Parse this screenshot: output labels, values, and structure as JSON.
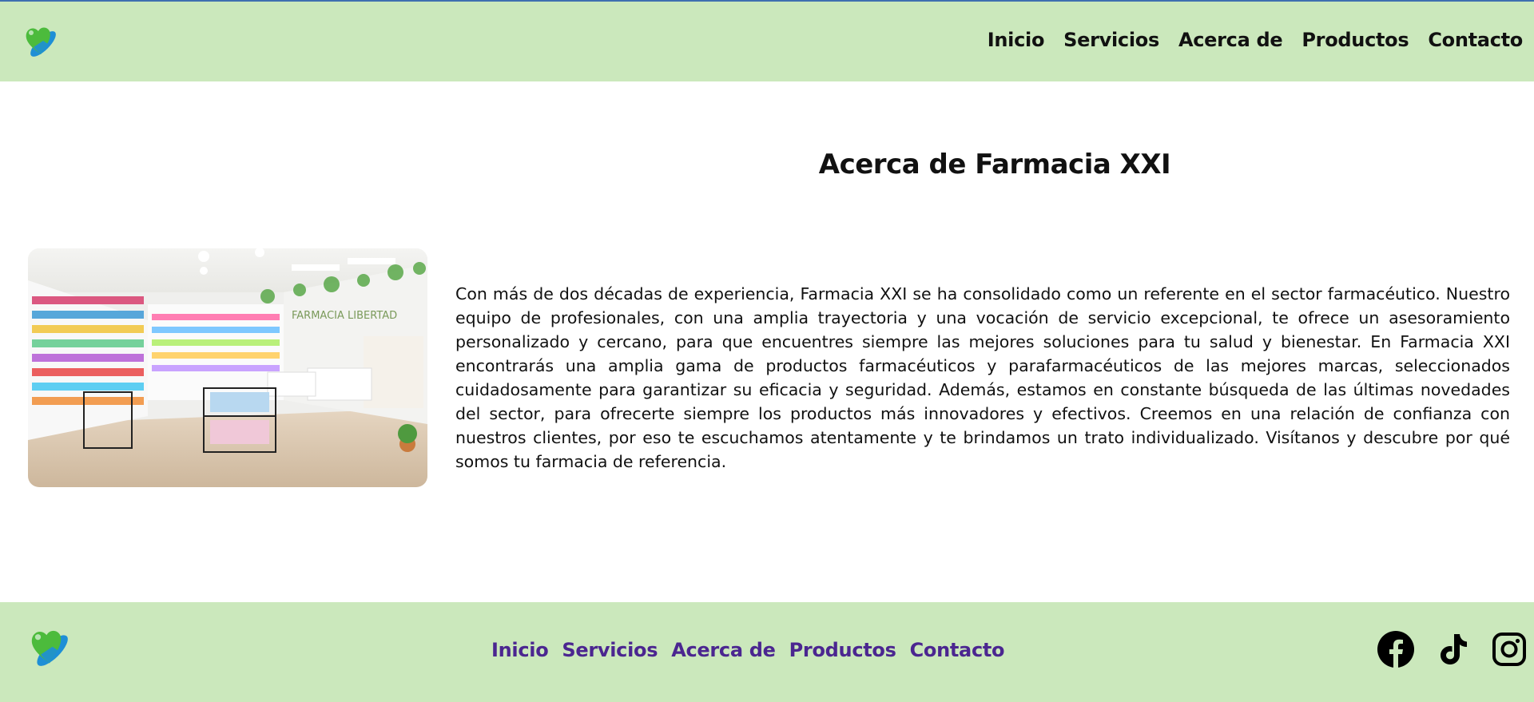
{
  "brand": {
    "logo_icon": "heart-capsule-logo-icon",
    "colors": {
      "header_bg": "#cbe8bc",
      "footer_link": "#4b2690",
      "logo_green": "#4cbb3c",
      "logo_blue": "#1e8fd6"
    }
  },
  "header": {
    "nav": [
      "Inicio",
      "Servicios",
      "Acerca de",
      "Productos",
      "Contacto"
    ]
  },
  "main": {
    "title": "Acerca de Farmacia XXI",
    "image_alt": "Interior de farmacia",
    "image_sign_text": "FARMACIA LIBERTAD",
    "paragraph": "Con más de dos décadas de experiencia, Farmacia XXI se ha consolidado como un referente en el sector farmacéutico. Nuestro equipo de profesionales, con una amplia trayectoria y una vocación de servicio excepcional, te ofrece un asesoramiento personalizado y cercano, para que encuentres siempre las mejores soluciones para tu salud y bienestar. En Farmacia XXI encontrarás una amplia gama de productos farmacéuticos y parafarmacéuticos de las mejores marcas, seleccionados cuidadosamente para garantizar su eficacia y seguridad. Además, estamos en constante búsqueda de las últimas novedades del sector, para ofrecerte siempre los productos más innovadores y efectivos. Creemos en una relación de confianza con nuestros clientes, por eso te escuchamos atentamente y te brindamos un trato individualizado. Visítanos y descubre por qué somos tu farmacia de referencia."
  },
  "footer": {
    "nav": [
      "Inicio",
      "Servicios",
      "Acerca de",
      "Productos",
      "Contacto"
    ],
    "social_icons": [
      "facebook-icon",
      "tiktok-icon",
      "instagram-icon"
    ]
  }
}
